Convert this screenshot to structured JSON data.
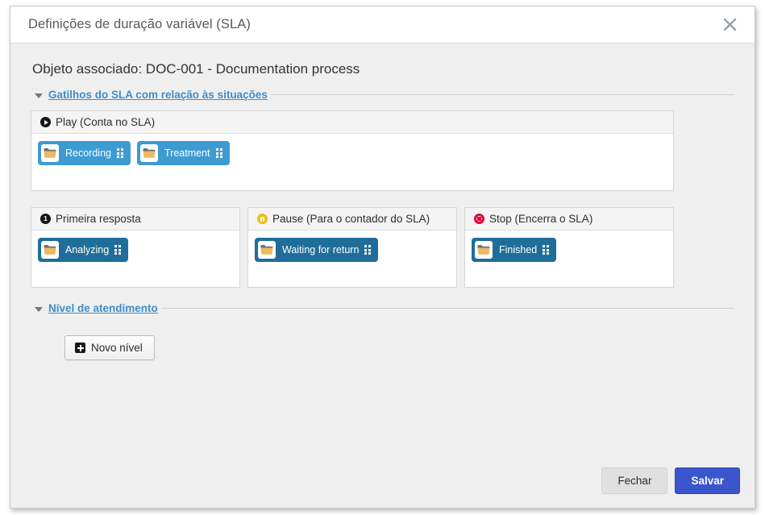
{
  "dialog": {
    "title": "Definições de duração variável (SLA)",
    "close_icon": "close-icon",
    "associated_object": "Objeto associado: DOC-001 - Documentation process"
  },
  "sections": {
    "triggers": {
      "link": "Gatilhos do SLA com relação às situações",
      "caret": "caret-down-icon"
    },
    "service_level": {
      "link": "Nível de atendimento",
      "caret": "caret-down-icon",
      "new_level_button": "Novo nível",
      "new_level_icon": "plus-square-icon"
    }
  },
  "panels": {
    "play": {
      "title": "Play (Conta no SLA)",
      "icon": "play-circle-icon",
      "icon_color": "#151515",
      "chips": [
        {
          "label": "Recording",
          "color": "#3d9bd1",
          "icon": "folder-icon",
          "handle": "drag-handle-icon"
        },
        {
          "label": "Treatment",
          "color": "#3d9bd1",
          "icon": "folder-icon",
          "handle": "drag-handle-icon"
        }
      ]
    },
    "first_response": {
      "title": "Primeira resposta",
      "icon": "number-one-circle-icon",
      "icon_color": "#151515",
      "chips": [
        {
          "label": "Analyzing",
          "color": "#1f6e99",
          "icon": "folder-icon",
          "handle": "drag-handle-icon"
        }
      ]
    },
    "pause": {
      "title": "Pause (Para o contador do SLA)",
      "icon": "pause-circle-icon",
      "icon_color": "#e7bd1b",
      "chips": [
        {
          "label": "Waiting for return",
          "color": "#1f6e99",
          "icon": "folder-icon",
          "handle": "drag-handle-icon"
        }
      ]
    },
    "stop": {
      "title": "Stop (Encerra o SLA)",
      "icon": "stop-circle-icon",
      "icon_color": "#e0063a",
      "chips": [
        {
          "label": "Finished",
          "color": "#1f6e99",
          "icon": "folder-icon",
          "handle": "drag-handle-icon"
        }
      ]
    }
  },
  "footer": {
    "close_label": "Fechar",
    "save_label": "Salvar",
    "save_color": "#3b55cc"
  }
}
